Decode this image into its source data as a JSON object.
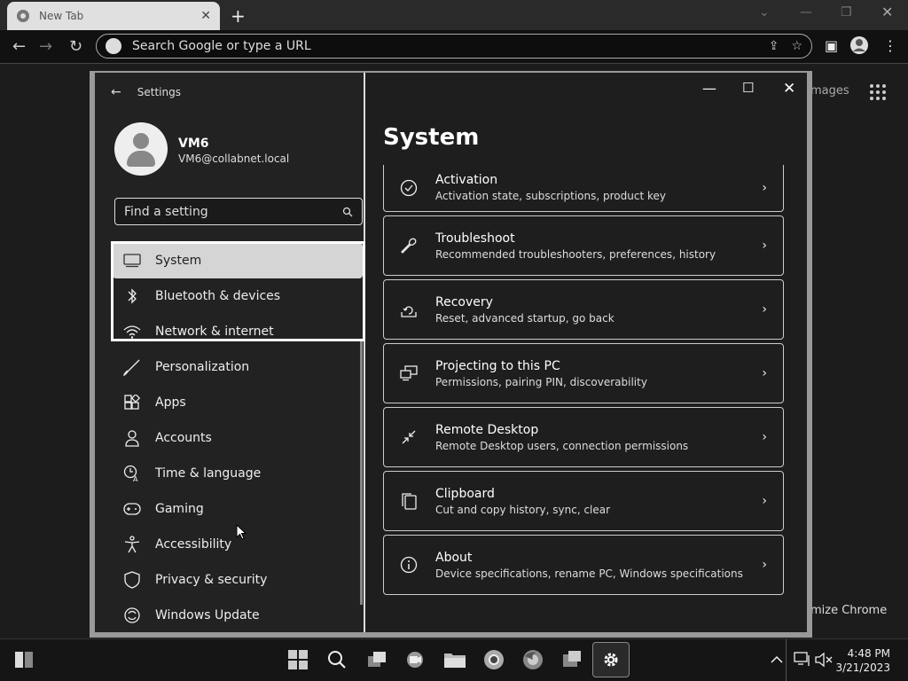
{
  "browser": {
    "tab_title": "New Tab",
    "omnibox_placeholder": "Search Google or type a URL",
    "bg_images_link": "Images",
    "bg_customize": "Customize Chrome"
  },
  "settings": {
    "app_title": "Settings",
    "user": {
      "name": "VM6",
      "email": "VM6@collabnet.local"
    },
    "search_placeholder": "Find a setting",
    "nav": [
      {
        "label": "System",
        "icon": "monitor-icon",
        "active": true
      },
      {
        "label": "Bluetooth & devices",
        "icon": "bluetooth-icon"
      },
      {
        "label": "Network & internet",
        "icon": "wifi-icon"
      },
      {
        "label": "Personalization",
        "icon": "brush-icon"
      },
      {
        "label": "Apps",
        "icon": "apps-icon"
      },
      {
        "label": "Accounts",
        "icon": "person-icon"
      },
      {
        "label": "Time & language",
        "icon": "clock-globe-icon"
      },
      {
        "label": "Gaming",
        "icon": "gamepad-icon"
      },
      {
        "label": "Accessibility",
        "icon": "accessibility-icon"
      },
      {
        "label": "Privacy & security",
        "icon": "shield-icon"
      },
      {
        "label": "Windows Update",
        "icon": "update-icon"
      }
    ],
    "page_title": "System",
    "cards": [
      {
        "title": "Activation",
        "subtitle": "Activation state, subscriptions, product key",
        "icon": "check-circle-icon"
      },
      {
        "title": "Troubleshoot",
        "subtitle": "Recommended troubleshooters, preferences, history",
        "icon": "wrench-icon"
      },
      {
        "title": "Recovery",
        "subtitle": "Reset, advanced startup, go back",
        "icon": "recovery-icon"
      },
      {
        "title": "Projecting to this PC",
        "subtitle": "Permissions, pairing PIN, discoverability",
        "icon": "project-icon"
      },
      {
        "title": "Remote Desktop",
        "subtitle": "Remote Desktop users, connection permissions",
        "icon": "remote-desktop-icon"
      },
      {
        "title": "Clipboard",
        "subtitle": "Cut and copy history, sync, clear",
        "icon": "clipboard-icon"
      },
      {
        "title": "About",
        "subtitle": "Device specifications, rename PC, Windows specifications",
        "icon": "info-icon"
      }
    ]
  },
  "taskbar": {
    "time": "4:48 PM",
    "date": "3/21/2023"
  }
}
